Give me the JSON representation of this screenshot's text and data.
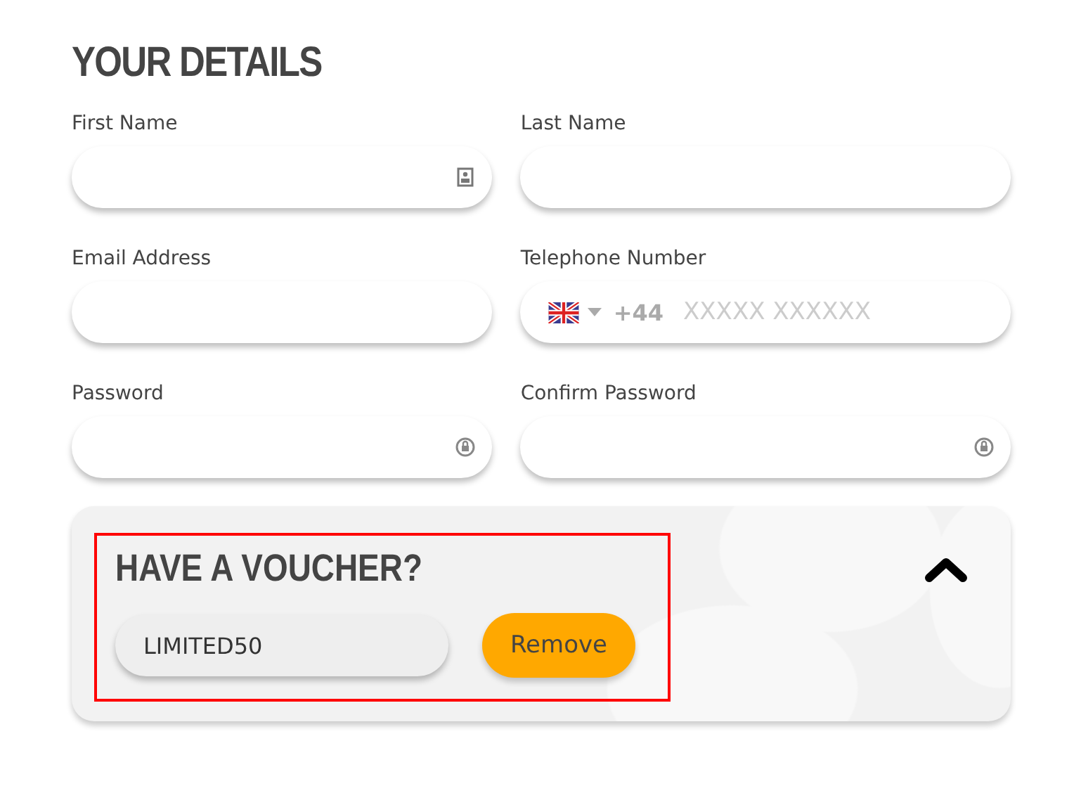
{
  "heading": "YOUR DETAILS",
  "fields": [
    {
      "label": "First Name",
      "kind": "contact"
    },
    {
      "label": "Last Name",
      "kind": "plain"
    },
    {
      "label": "Email Address",
      "kind": "plain"
    },
    {
      "label": "Telephone Number",
      "kind": "phone",
      "dial_code": "+44",
      "placeholder": "XXXXX XXXXXX"
    },
    {
      "label": "Password",
      "kind": "password"
    },
    {
      "label": "Confirm Password",
      "kind": "password"
    }
  ],
  "voucher": {
    "title": "HAVE A VOUCHER?",
    "expanded": true,
    "code": "LIMITED50",
    "button": "Remove"
  }
}
